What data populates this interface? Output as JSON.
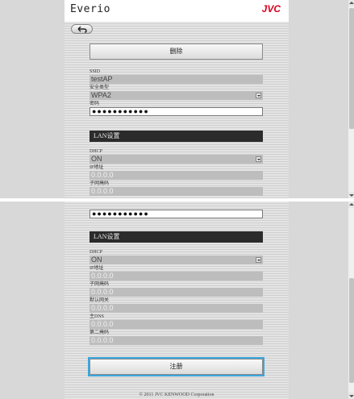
{
  "app": {
    "title": "Everio",
    "logo": "JVC"
  },
  "back_icon": "back-arrow-icon",
  "delete_label": "删除",
  "register_label": "注册",
  "ssid": {
    "label": "SSID",
    "value": "testAP"
  },
  "security": {
    "label": "安全类型",
    "value": "WPA2"
  },
  "password": {
    "label": "密码",
    "value": "●●●●●●●●●●●"
  },
  "lan": {
    "header": "LAN设置",
    "dhcp": {
      "label": "DHCP",
      "value": "ON"
    },
    "ip": {
      "label": "IP地址",
      "value": "0.0.0.0"
    },
    "subnet": {
      "label": "子网掩码",
      "value": "0.0.0.0"
    },
    "gateway": {
      "label": "默认网关",
      "value": "0.0.0.0"
    },
    "dns1": {
      "label": "主DNS",
      "value": "0.0.0.0"
    },
    "dns2": {
      "label": "第二掩码",
      "value": "0.0.0.0"
    }
  },
  "footer": "© 2011 JVC KENWOOD Corporation",
  "colors": {
    "brand_red": "#d6001c",
    "focus_ring": "#3aa6dd",
    "section_bg": "#2b2b2b"
  }
}
